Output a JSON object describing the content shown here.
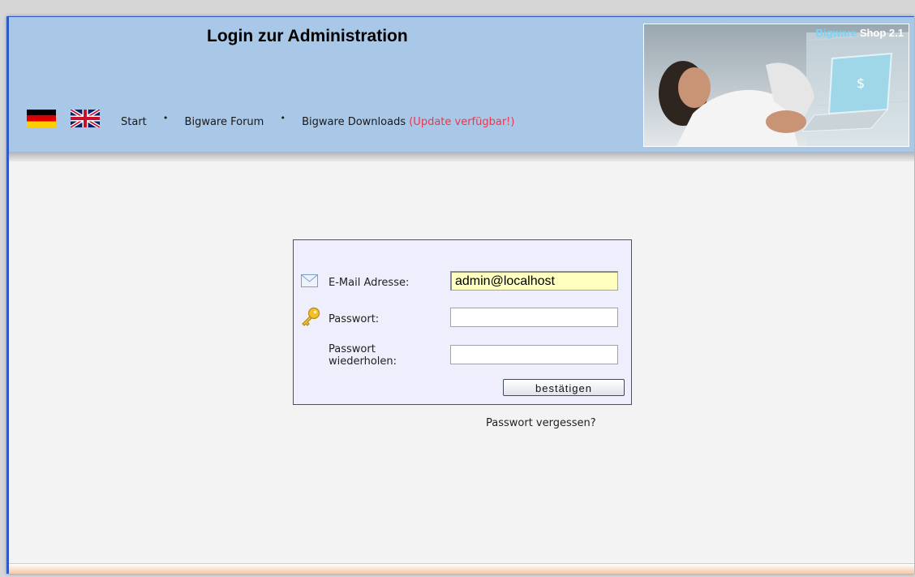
{
  "header": {
    "title": "Login zur Administration",
    "brand": {
      "part1": "Bigware",
      "part2": "Shop 2.1"
    },
    "nav": {
      "start": "Start",
      "forum": "Bigware Forum",
      "downloads": "Bigware Downloads",
      "update": "(Update verfügbar!)",
      "separator": "•"
    },
    "flags": [
      "german-flag-icon",
      "uk-flag-icon"
    ]
  },
  "login": {
    "email_label": "E-Mail Adresse:",
    "email_value": "admin@localhost",
    "password_label": "Passwort:",
    "password_value": "",
    "repeat_label_line1": "Passwort",
    "repeat_label_line2": "wiederholen:",
    "repeat_value": "",
    "submit_label": "bestätigen",
    "icons": [
      "envelope-icon",
      "key-icon"
    ]
  },
  "forgot_link": "Passwort vergessen?",
  "colors": {
    "header_bg": "#a9c7e6",
    "update_text": "#f0364a",
    "box_bg": "#eeeefc",
    "filled_input_bg": "#ffffc0",
    "frame_border": "#2f58c8"
  }
}
